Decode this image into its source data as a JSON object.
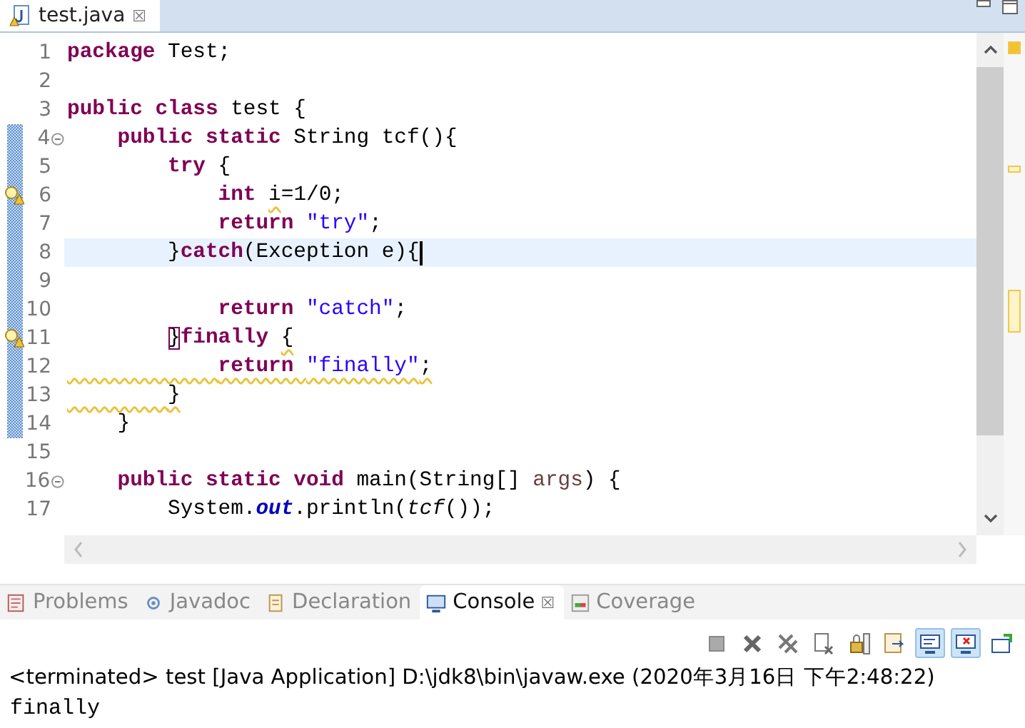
{
  "editor": {
    "tab": {
      "label": "test.java",
      "close": "☒"
    },
    "lines": [
      {
        "number": "1",
        "current": false,
        "changed": false,
        "warning": false,
        "folding": false,
        "squiggle": false,
        "tokens": [
          {
            "kind": "kw",
            "text": "package "
          },
          {
            "kind": "text",
            "text": "Test;"
          }
        ]
      },
      {
        "number": "2",
        "current": false,
        "changed": false,
        "warning": false,
        "folding": false
      },
      {
        "number": "3",
        "current": false,
        "changed": false,
        "warning": false,
        "folding": false,
        "squiggle": false,
        "tokens": [
          {
            "kind": "kw",
            "text": "public class "
          },
          {
            "kind": "text",
            "text": "test {"
          }
        ]
      },
      {
        "number": "4",
        "current": false,
        "changed": true,
        "warning": false,
        "folding": true,
        "squiggle": false,
        "tokens": [
          {
            "kind": "kw",
            "text": "    public static "
          },
          {
            "kind": "text",
            "text": "String tcf(){"
          }
        ]
      },
      {
        "number": "5",
        "current": false,
        "changed": true,
        "warning": false,
        "folding": false,
        "squiggle": false,
        "tokens": [
          {
            "kind": "kw",
            "text": "        try "
          },
          {
            "kind": "text",
            "text": "{"
          }
        ]
      },
      {
        "number": "6",
        "current": false,
        "changed": true,
        "warning": true,
        "folding": false,
        "squiggle": false,
        "tokens": [
          {
            "kind": "kw",
            "text": "            int "
          },
          {
            "kind": "warn",
            "text": "i"
          },
          {
            "kind": "text",
            "text": "=1/0;"
          }
        ]
      },
      {
        "number": "7",
        "current": false,
        "changed": true,
        "warning": false,
        "folding": false,
        "squiggle": false,
        "tokens": [
          {
            "kind": "kw",
            "text": "            return "
          },
          {
            "kind": "str",
            "text": "\"try\""
          },
          {
            "kind": "text",
            "text": ";"
          }
        ]
      },
      {
        "number": "8",
        "current": true,
        "changed": true,
        "warning": false,
        "folding": false,
        "squiggle": false,
        "tokens": [
          {
            "kind": "text",
            "text": "        }"
          },
          {
            "kind": "kw",
            "text": "catch"
          },
          {
            "kind": "text",
            "text": "(Exception e){"
          }
        ]
      },
      {
        "number": "9",
        "current": false,
        "changed": true,
        "warning": false,
        "folding": false
      },
      {
        "number": "10",
        "current": false,
        "changed": true,
        "warning": false,
        "folding": false,
        "squiggle": false,
        "tokens": [
          {
            "kind": "kw",
            "text": "            return "
          },
          {
            "kind": "str",
            "text": "\"catch\""
          },
          {
            "kind": "text",
            "text": ";"
          }
        ]
      },
      {
        "number": "11",
        "current": false,
        "changed": true,
        "warning": true,
        "folding": false,
        "squiggle": false,
        "tokens": [
          {
            "kind": "match",
            "text": "        }"
          },
          {
            "kind": "kw",
            "text": "finally "
          },
          {
            "kind": "warn",
            "text": "{"
          }
        ]
      },
      {
        "number": "12",
        "current": false,
        "changed": true,
        "warning": false,
        "folding": false,
        "squiggle": true,
        "tokens": [
          {
            "kind": "kw",
            "text": "            return "
          },
          {
            "kind": "str",
            "text": "\"finally\""
          },
          {
            "kind": "text",
            "text": ";"
          }
        ]
      },
      {
        "number": "13",
        "current": false,
        "changed": true,
        "warning": false,
        "folding": false,
        "squiggle": true,
        "tokens": [
          {
            "kind": "text",
            "text": "        }"
          }
        ]
      },
      {
        "number": "14",
        "current": false,
        "changed": true,
        "warning": false,
        "folding": false,
        "squiggle": false,
        "tokens": [
          {
            "kind": "text",
            "text": "    }"
          }
        ]
      },
      {
        "number": "15",
        "current": false,
        "changed": false,
        "warning": false,
        "folding": false
      },
      {
        "number": "16",
        "current": false,
        "changed": false,
        "warning": false,
        "folding": true,
        "squiggle": false,
        "tokens": [
          {
            "kind": "kw",
            "text": "    public static void "
          },
          {
            "kind": "text",
            "text": "main(String[] "
          },
          {
            "kind": "param",
            "text": "args"
          },
          {
            "kind": "text",
            "text": ") {"
          }
        ]
      },
      {
        "number": "17",
        "current": false,
        "changed": false,
        "warning": false,
        "folding": false,
        "squiggle": false,
        "tokens": [
          {
            "kind": "text",
            "text": "        System."
          },
          {
            "kind": "field",
            "text": "out"
          },
          {
            "kind": "text",
            "text": ".println("
          },
          {
            "kind": "italic",
            "text": "tcf"
          },
          {
            "kind": "text",
            "text": "());"
          }
        ]
      }
    ]
  },
  "panel": {
    "tabs": [
      {
        "label": "Problems",
        "selected": false
      },
      {
        "label": "Javadoc",
        "selected": false
      },
      {
        "label": "Declaration",
        "selected": false
      },
      {
        "label": "Console",
        "selected": true,
        "close": "☒"
      },
      {
        "label": "Coverage",
        "selected": false
      }
    ],
    "toolbar": [
      {
        "pressed": false
      },
      {
        "pressed": false
      },
      {
        "pressed": false
      },
      {
        "pressed": false
      },
      {
        "pressed": false
      },
      {
        "pressed": false
      },
      {
        "pressed": true
      },
      {
        "pressed": true
      },
      {
        "pressed": false
      }
    ],
    "header": "<terminated> test [Java Application] D:\\jdk8\\bin\\javaw.exe (2020年3月16日 下午2:48:22)",
    "output": [
      "finally"
    ]
  }
}
